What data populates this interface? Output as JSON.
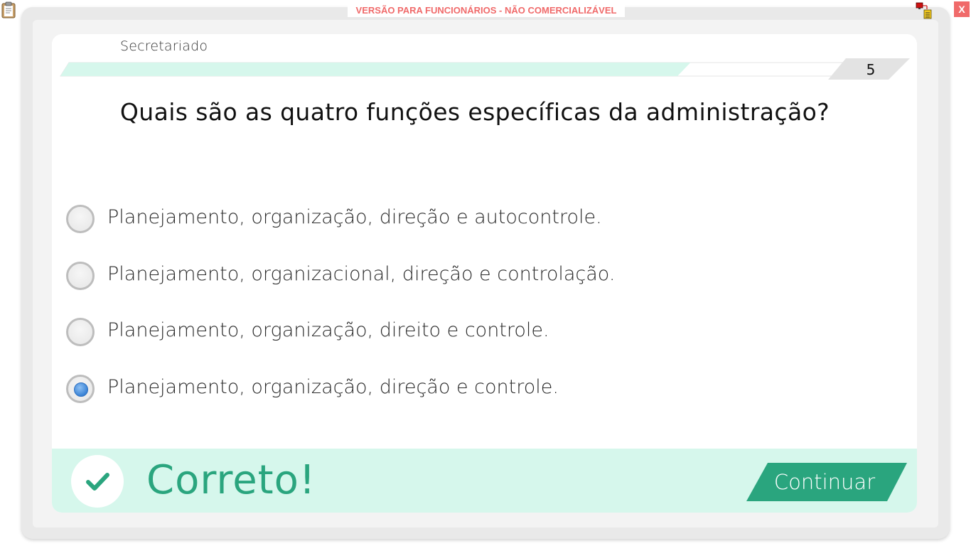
{
  "window": {
    "banner": "VERSÃO PARA FUNCIONÁRIOS - NÃO COMERCIALIZÁVEL",
    "close_label": "X"
  },
  "header": {
    "subject": "Secretariado",
    "question_count": "5",
    "progress": 0.8
  },
  "question": {
    "text": "Quais são as quatro funções específicas da administração?"
  },
  "options": [
    {
      "label": "Planejamento, organização, direção e autocontrole.",
      "selected": false
    },
    {
      "label": "Planejamento, organizacional, direção e controlação.",
      "selected": false
    },
    {
      "label": "Planejamento, organização, direito e controle.",
      "selected": false
    },
    {
      "label": "Planejamento, organização, direção e controle.",
      "selected": true
    }
  ],
  "feedback": {
    "message": "Correto!",
    "continue_label": "Continuar"
  },
  "colors": {
    "accent_green": "#2aa57e",
    "feedback_bg": "#d6f7ec",
    "banner_red": "#f06a6a",
    "radio_selected": "#3b84d6"
  },
  "icons": {
    "clipboard": "clipboard-icon",
    "network": "network-status-icon",
    "check": "checkmark-icon"
  }
}
